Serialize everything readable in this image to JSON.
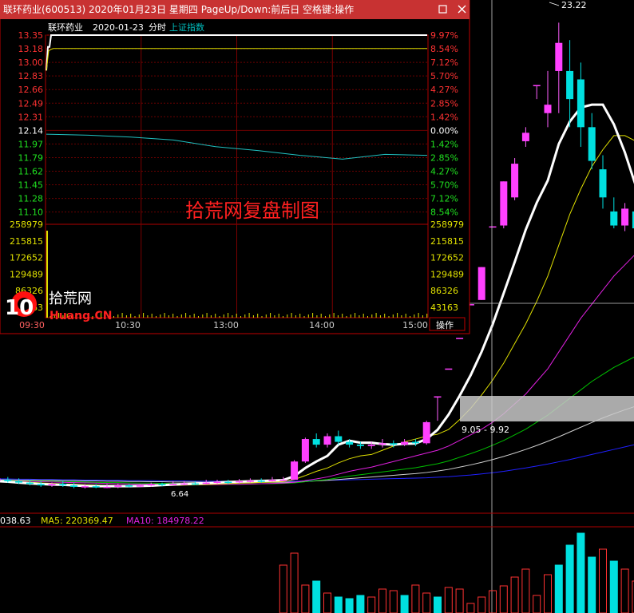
{
  "window": {
    "title": "联环药业(600513) 2020年01月23日 星期四 PageUp/Down:前后日 空格键:操作",
    "subheader_name": "联环药业",
    "subheader_date": "2020-01-23",
    "subheader_mode": "分时",
    "subheader_index": "上证指数",
    "action_label": "操作",
    "watermark": "拾荒网复盘制图"
  },
  "logo": {
    "number": "10",
    "text_cn": "拾荒网",
    "text_en": "Huang.CN"
  },
  "colors": {
    "up": "#ff3232",
    "down": "#00e0e0",
    "ma5": "#ffffff",
    "ma10": "#e0e000",
    "ma20": "#e020e0",
    "ma30": "#00c000",
    "ma60": "#d0d0d0",
    "ma120": "#2020ff"
  },
  "chart_data": [
    {
      "type": "line",
      "name": "intraday",
      "x_ticks": [
        "09:30",
        "10:30",
        "13:00",
        "14:00",
        "15:00"
      ],
      "price_ticks": [
        "13.35",
        "13.18",
        "13.00",
        "12.83",
        "12.66",
        "12.49",
        "12.31",
        "12.14",
        "11.97",
        "11.79",
        "11.62",
        "11.45",
        "11.28",
        "11.10"
      ],
      "pct_ticks": [
        "9.97%",
        "8.54%",
        "7.12%",
        "5.70%",
        "4.27%",
        "2.85%",
        "1.42%",
        "0.00%",
        "1.42%",
        "2.85%",
        "4.27%",
        "5.70%",
        "7.12%",
        "8.54%"
      ],
      "volume_ticks": [
        "258979",
        "215815",
        "172652",
        "129489",
        "86326",
        "43163"
      ],
      "prev_close": 12.14,
      "price_series": [
        12.9,
        13.2,
        13.2,
        13.35,
        13.35,
        13.35,
        13.35,
        13.35,
        13.35
      ],
      "avg_series": [
        12.9,
        13.15,
        13.17,
        13.18,
        13.18,
        13.18,
        13.18,
        13.18,
        13.18
      ],
      "index_pct_series": [
        -0.4,
        -0.5,
        -0.7,
        -1.0,
        -1.7,
        -2.1,
        -2.6,
        -3.0,
        -2.5,
        -2.6
      ]
    },
    {
      "type": "candlestick",
      "name": "daily",
      "annotations": {
        "high": "23.22",
        "low": "6.64",
        "range": "9.05 - 9.92"
      },
      "candles": [
        [
          6.9,
          7.0,
          7.1,
          6.8
        ],
        [
          6.95,
          6.9,
          7.05,
          6.85
        ],
        [
          6.9,
          6.85,
          7.0,
          6.8
        ],
        [
          6.85,
          6.8,
          6.95,
          6.75
        ],
        [
          6.8,
          6.75,
          6.9,
          6.7
        ],
        [
          6.75,
          6.8,
          6.85,
          6.7
        ],
        [
          6.8,
          6.75,
          6.9,
          6.7
        ],
        [
          6.75,
          6.7,
          6.85,
          6.65
        ],
        [
          6.7,
          6.72,
          6.8,
          6.64
        ],
        [
          6.72,
          6.7,
          6.8,
          6.65
        ],
        [
          6.7,
          6.7,
          6.8,
          6.65
        ],
        [
          6.7,
          6.75,
          6.8,
          6.65
        ],
        [
          6.75,
          6.72,
          6.8,
          6.68
        ],
        [
          6.72,
          6.75,
          6.8,
          6.7
        ],
        [
          6.75,
          6.8,
          6.85,
          6.7
        ],
        [
          6.8,
          6.78,
          6.85,
          6.72
        ],
        [
          6.78,
          6.8,
          6.9,
          6.75
        ],
        [
          6.8,
          6.82,
          6.9,
          6.75
        ],
        [
          6.82,
          6.8,
          6.9,
          6.76
        ],
        [
          6.8,
          6.85,
          6.95,
          6.78
        ],
        [
          6.85,
          6.88,
          6.95,
          6.8
        ],
        [
          6.88,
          6.86,
          6.95,
          6.8
        ],
        [
          6.86,
          6.9,
          6.98,
          6.82
        ],
        [
          6.9,
          6.92,
          7.0,
          6.85
        ],
        [
          6.92,
          6.9,
          7.0,
          6.85
        ],
        [
          6.9,
          6.95,
          7.05,
          6.88
        ],
        [
          6.95,
          6.95,
          7.05,
          6.9
        ],
        [
          6.95,
          7.6,
          7.65,
          6.95
        ],
        [
          7.6,
          8.4,
          8.45,
          7.55
        ],
        [
          8.4,
          8.2,
          8.6,
          8.1
        ],
        [
          8.2,
          8.5,
          8.6,
          8.1
        ],
        [
          8.5,
          8.3,
          8.7,
          8.2
        ],
        [
          8.3,
          8.2,
          8.4,
          8.1
        ],
        [
          8.2,
          8.15,
          8.3,
          8.05
        ],
        [
          8.15,
          8.2,
          8.3,
          8.05
        ],
        [
          8.2,
          8.25,
          8.4,
          8.1
        ],
        [
          8.25,
          8.2,
          8.35,
          8.1
        ],
        [
          8.2,
          8.3,
          8.4,
          8.15
        ],
        [
          8.3,
          8.25,
          8.4,
          8.15
        ],
        [
          8.25,
          9.0,
          9.05,
          8.2
        ],
        [
          9.92,
          9.92,
          9.92,
          9.05
        ],
        [
          10.91,
          10.91,
          10.91,
          10.91
        ],
        [
          12.0,
          12.0,
          12.0,
          12.0
        ],
        [
          13.2,
          13.2,
          13.2,
          13.2
        ],
        [
          13.35,
          14.52,
          14.52,
          13.35
        ],
        [
          15.97,
          15.97,
          15.97,
          15.97
        ],
        [
          16.0,
          17.57,
          17.57,
          15.9
        ],
        [
          17.0,
          18.2,
          18.4,
          16.9
        ],
        [
          19.0,
          19.3,
          19.5,
          18.8
        ],
        [
          21.0,
          21.0,
          21.0,
          20.5
        ],
        [
          20.0,
          20.3,
          21.5,
          19.5
        ],
        [
          21.5,
          22.5,
          23.22,
          20.0
        ],
        [
          21.5,
          20.5,
          22.6,
          19.5
        ],
        [
          21.2,
          19.5,
          21.8,
          18.8
        ],
        [
          19.5,
          18.3,
          20.0,
          18.0
        ],
        [
          18.0,
          17.0,
          18.5,
          16.6
        ],
        [
          16.5,
          16.0,
          17.0,
          15.9
        ],
        [
          16.0,
          16.6,
          16.8,
          15.8
        ],
        [
          16.5,
          15.9,
          16.9,
          15.6
        ],
        [
          15.8,
          15.2,
          16.0,
          14.9
        ],
        [
          15.2,
          16.0,
          16.1,
          15.0
        ]
      ],
      "ma5": [
        6.9,
        6.88,
        6.85,
        6.82,
        6.8,
        6.78,
        6.77,
        6.75,
        6.73,
        6.72,
        6.72,
        6.72,
        6.72,
        6.73,
        6.74,
        6.76,
        6.78,
        6.8,
        6.81,
        6.83,
        6.85,
        6.87,
        6.88,
        6.9,
        6.91,
        6.92,
        6.94,
        7.08,
        7.37,
        7.6,
        7.8,
        8.2,
        8.34,
        8.27,
        8.27,
        8.22,
        8.2,
        8.23,
        8.24,
        8.4,
        8.73,
        9.27,
        9.94,
        10.67,
        11.51,
        12.48,
        13.59,
        14.7,
        15.85,
        16.81,
        17.6,
        18.9,
        19.7,
        20.2,
        20.3,
        20.3,
        19.6,
        18.6,
        17.4,
        16.5,
        16.0
      ],
      "ma10": [
        6.9,
        6.9,
        6.88,
        6.86,
        6.84,
        6.82,
        6.8,
        6.79,
        6.77,
        6.76,
        6.75,
        6.75,
        6.74,
        6.74,
        6.74,
        6.75,
        6.75,
        6.76,
        6.77,
        6.78,
        6.8,
        6.81,
        6.83,
        6.84,
        6.86,
        6.87,
        6.89,
        6.96,
        7.1,
        7.25,
        7.37,
        7.55,
        7.7,
        7.8,
        7.85,
        8.0,
        8.15,
        8.3,
        8.4,
        8.5,
        8.57,
        8.74,
        9.09,
        9.49,
        9.97,
        10.5,
        11.1,
        11.8,
        12.5,
        13.3,
        14.2,
        15.3,
        16.4,
        17.3,
        18.1,
        18.7,
        19.2,
        19.2,
        19.0,
        18.5,
        18.2
      ],
      "ma20": [
        6.9,
        6.9,
        6.9,
        6.89,
        6.88,
        6.87,
        6.86,
        6.85,
        6.84,
        6.83,
        6.82,
        6.81,
        6.8,
        6.79,
        6.79,
        6.78,
        6.78,
        6.78,
        6.78,
        6.78,
        6.78,
        6.79,
        6.79,
        6.8,
        6.81,
        6.82,
        6.83,
        6.86,
        6.92,
        6.98,
        7.05,
        7.15,
        7.25,
        7.33,
        7.4,
        7.5,
        7.6,
        7.7,
        7.8,
        7.9,
        8.0,
        8.15,
        8.35,
        8.55,
        8.75,
        9.0,
        9.3,
        9.65,
        10.0,
        10.45,
        10.9,
        11.5,
        12.1,
        12.7,
        13.2,
        13.7,
        14.2,
        14.6,
        15.0,
        15.3,
        15.6
      ],
      "ma30": [
        6.92,
        6.92,
        6.91,
        6.91,
        6.9,
        6.9,
        6.89,
        6.88,
        6.87,
        6.86,
        6.85,
        6.85,
        6.84,
        6.83,
        6.83,
        6.82,
        6.82,
        6.81,
        6.81,
        6.81,
        6.8,
        6.8,
        6.8,
        6.8,
        6.81,
        6.81,
        6.82,
        6.84,
        6.88,
        6.92,
        6.96,
        7.02,
        7.08,
        7.13,
        7.18,
        7.23,
        7.28,
        7.33,
        7.38,
        7.45,
        7.52,
        7.62,
        7.75,
        7.88,
        8.02,
        8.18,
        8.35,
        8.55,
        8.75,
        9.0,
        9.25,
        9.55,
        9.85,
        10.15,
        10.45,
        10.7,
        10.95,
        11.15,
        11.35,
        11.55,
        11.75
      ],
      "ma60": [
        6.95,
        6.95,
        6.94,
        6.94,
        6.93,
        6.93,
        6.92,
        6.92,
        6.91,
        6.91,
        6.9,
        6.9,
        6.89,
        6.89,
        6.88,
        6.88,
        6.87,
        6.87,
        6.87,
        6.86,
        6.86,
        6.86,
        6.86,
        6.86,
        6.86,
        6.86,
        6.86,
        6.87,
        6.89,
        6.91,
        6.93,
        6.96,
        6.99,
        7.02,
        7.05,
        7.08,
        7.11,
        7.14,
        7.17,
        7.21,
        7.26,
        7.32,
        7.4,
        7.48,
        7.57,
        7.67,
        7.78,
        7.9,
        8.03,
        8.17,
        8.32,
        8.48,
        8.65,
        8.82,
        8.99,
        9.15,
        9.3,
        9.44,
        9.57,
        9.7,
        9.82
      ],
      "ma120": [
        6.98,
        6.98,
        6.97,
        6.97,
        6.96,
        6.96,
        6.95,
        6.95,
        6.94,
        6.94,
        6.93,
        6.93,
        6.92,
        6.92,
        6.92,
        6.91,
        6.91,
        6.91,
        6.9,
        6.9,
        6.9,
        6.9,
        6.9,
        6.9,
        6.9,
        6.9,
        6.9,
        6.9,
        6.91,
        6.92,
        6.93,
        6.94,
        6.95,
        6.96,
        6.97,
        6.98,
        6.99,
        7.0,
        7.01,
        7.02,
        7.04,
        7.06,
        7.09,
        7.12,
        7.16,
        7.2,
        7.25,
        7.31,
        7.37,
        7.44,
        7.51,
        7.59,
        7.67,
        7.76,
        7.85,
        7.94,
        8.03,
        8.12,
        8.21,
        8.3,
        8.39
      ],
      "ma_labels": {
        "ma_partial": "038.63",
        "ma5": "MA5: 220369.47",
        "ma10": "MA10: 184978.22"
      },
      "volume_bars": [
        [
          26,
          1
        ],
        [
          27,
          1
        ],
        [
          28,
          1
        ],
        [
          29,
          0
        ],
        [
          30,
          1
        ],
        [
          31,
          0
        ],
        [
          32,
          0
        ],
        [
          33,
          0
        ],
        [
          34,
          1
        ],
        [
          35,
          1
        ],
        [
          36,
          1
        ],
        [
          37,
          0
        ],
        [
          38,
          1
        ],
        [
          39,
          1
        ],
        [
          40,
          0
        ],
        [
          41,
          1
        ],
        [
          42,
          1
        ],
        [
          43,
          1
        ],
        [
          44,
          1
        ],
        [
          45,
          1
        ],
        [
          46,
          1
        ],
        [
          47,
          1
        ],
        [
          48,
          1
        ],
        [
          49,
          1
        ],
        [
          50,
          1
        ],
        [
          51,
          0
        ],
        [
          52,
          0
        ],
        [
          53,
          0
        ],
        [
          54,
          0
        ],
        [
          55,
          1
        ],
        [
          56,
          0
        ],
        [
          57,
          1
        ],
        [
          58,
          1
        ],
        [
          59,
          0
        ],
        [
          60,
          1
        ]
      ],
      "volume_heights": [
        60,
        75,
        35,
        40,
        25,
        20,
        18,
        22,
        20,
        30,
        28,
        22,
        35,
        25,
        20,
        32,
        30,
        12,
        20,
        28,
        34,
        45,
        55,
        22,
        48,
        60,
        85,
        100,
        70,
        80,
        65,
        55,
        40,
        55,
        50
      ]
    }
  ]
}
